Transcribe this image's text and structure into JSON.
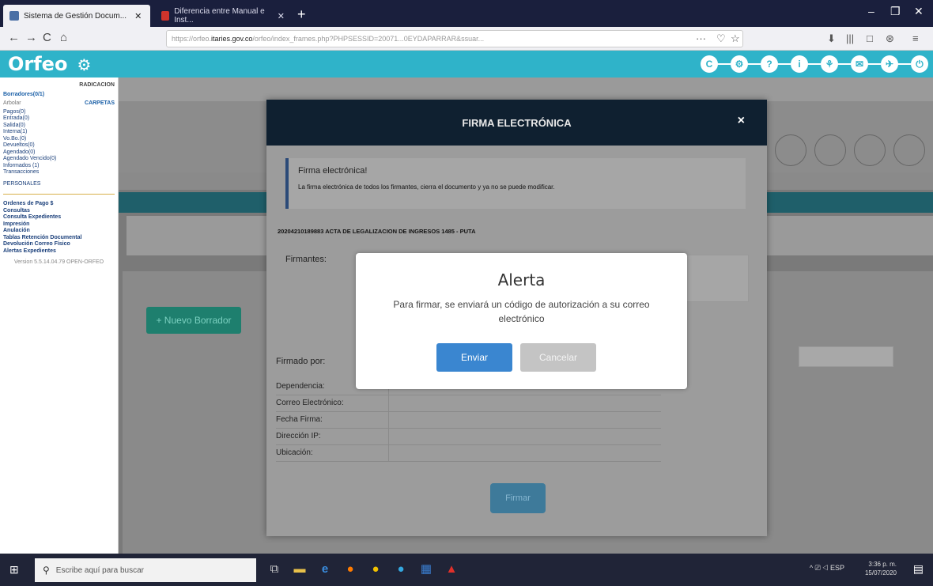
{
  "browser": {
    "tabs": [
      {
        "label": "Sistema de Gestión Docum...",
        "favicon_color": "#4a6fa5"
      },
      {
        "label": "Diferencia entre Manual e Inst...",
        "favicon_color": "#d0342c"
      }
    ],
    "new_tab": "+",
    "window_controls": {
      "minimize": "–",
      "maximize": "❐",
      "close": "✕"
    },
    "nav": {
      "back": "←",
      "forward": "→",
      "reload": "C",
      "home": "⌂"
    },
    "url": {
      "prefix": "https://orfeo.",
      "domain": "itaries.gov.co",
      "rest": "/orfeo/index_frames.php?PHPSESSID=20071...0EYDAPARRAR&ssuar..."
    },
    "toolbar_icons": [
      "···",
      "♡",
      "☆",
      "⬇",
      "|||",
      "□",
      "⊛",
      "≡"
    ]
  },
  "orfeo": {
    "logo": "Orfeo",
    "header_icons": [
      "C",
      "⚙",
      "?",
      "i",
      "⚘",
      "✉",
      "✈",
      "⏻"
    ]
  },
  "sidebar": {
    "radicacion": "RADICACION",
    "borradores": "Borradores(0/1)",
    "arbol": "Arbolar",
    "carpetas": "CARPETAS",
    "items": [
      "Pagos(0)",
      "Entrada(0)",
      "Salida(0)",
      "Interna(1)",
      "Vo.Bo.(0)",
      "Devueltos(0)",
      "Agendado(0)",
      "Agendado Vencido(0)",
      "Informados (1)",
      "Transacciones",
      "PERSONALES"
    ],
    "items2": [
      "Ordenes de Pago $",
      "Consultas",
      "Consulta Expedientes",
      "Impresión",
      "Anulación",
      "Tablas Retención Documental",
      "Devolución Correo Físico",
      "Alertas Expedientes"
    ],
    "version": "Version 5.5.14.04.79 OPEN-ORFEO"
  },
  "background": {
    "new_button": "+ Nuevo Borrador"
  },
  "modal": {
    "title": "FIRMA ELECTRÓNICA",
    "close": "×",
    "info_title": "Firma electrónica!",
    "info_text": "La firma electrónica de todos los firmantes, cierra el documento y ya no se puede modificar.",
    "document": "20204210189883 ACTA DE LEGALIZACION DE INGRESOS 1485 - PUTA",
    "firmantes_label": "Firmantes:",
    "firmado_label": "Firmado por:",
    "fields": [
      "Dependencia:",
      "Correo Electrónico:",
      "Fecha Firma:",
      "Dirección IP:",
      "Ubicación:"
    ],
    "firmar_button": "Firmar"
  },
  "alert": {
    "title": "Alerta",
    "message": "Para firmar, se enviará un código de autorización a su correo electrónico",
    "send_button": "Enviar",
    "cancel_button": "Cancelar"
  },
  "taskbar": {
    "search_placeholder": "Escribe aquí para buscar",
    "time": "3:36 p. m.",
    "date": "15/07/2020",
    "lang": "ESP"
  }
}
